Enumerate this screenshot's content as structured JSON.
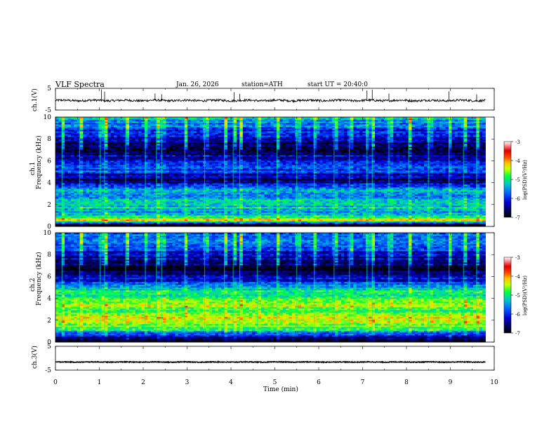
{
  "header": {
    "title": "VLF  Spectra",
    "date": "Jan. 26, 2026",
    "station": "station=ATH",
    "start": "start  UT  =   20:40:0"
  },
  "axes": {
    "x_label": "Time  (min)",
    "x_ticks": [
      "0",
      "1",
      "2",
      "3",
      "4",
      "5",
      "6",
      "7",
      "8",
      "9",
      "10"
    ],
    "ch1_label": "ch.1(V)",
    "ch3_label": "ch.3(V)",
    "ch1_spec_label": "ch.1",
    "ch2_spec_label": "ch.2",
    "freq_label": "Frequency  (kHz)",
    "wave_ticks": [
      "5",
      "-5"
    ],
    "freq_ticks": [
      "0",
      "2",
      "4",
      "6",
      "8",
      "10"
    ]
  },
  "colorbar": {
    "label": "log(PSD)(V²/Hz)",
    "ticks": [
      "-3",
      "-4",
      "-5",
      "-6",
      "-7"
    ],
    "colors": [
      "#ffffff",
      "#ff8080",
      "#e00000",
      "#ff8c00",
      "#ffff00",
      "#00ff00",
      "#00c8a0",
      "#00a0ff",
      "#0040ff",
      "#0000c0",
      "#000040",
      "#000000"
    ]
  },
  "chart_data": [
    {
      "type": "line",
      "panel": "ch.1 waveform",
      "ylabel": "ch.1(V)",
      "xlabel": "Time  (min)",
      "xlim": [
        0,
        10
      ],
      "ylim": [
        -5,
        5
      ],
      "data_xlim": [
        0,
        9.8
      ],
      "baseline": -0.6,
      "noise_amplitude": 0.5,
      "spikes": [
        {
          "x": 1.05,
          "y": 4.5
        },
        {
          "x": 1.12,
          "y": 3.5
        },
        {
          "x": 2.27,
          "y": 2.6
        },
        {
          "x": 2.42,
          "y": 2.3
        },
        {
          "x": 4.07,
          "y": 3.2
        },
        {
          "x": 4.2,
          "y": 2.4
        },
        {
          "x": 7.1,
          "y": 4.0
        },
        {
          "x": 7.22,
          "y": 4.4
        },
        {
          "x": 7.6,
          "y": 2.6
        },
        {
          "x": 8.97,
          "y": 3.6
        },
        {
          "x": 9.6,
          "y": 2.2
        }
      ]
    },
    {
      "type": "heatmap",
      "panel": "ch.1 spectrogram",
      "xlabel": "Time  (min)",
      "ylabel": "Frequency  (kHz)",
      "xlim": [
        0,
        10
      ],
      "ylim": [
        0,
        10
      ],
      "data_xlim": [
        0,
        9.8
      ],
      "zlabel": "log(PSD)(V²/Hz)",
      "zlim": [
        -7,
        -3
      ],
      "bands_khz": [
        {
          "f": 0.2,
          "logpsd": -7.0
        },
        {
          "f": 0.6,
          "logpsd": -4.3
        },
        {
          "f": 1.2,
          "logpsd": -5.4
        },
        {
          "f": 2.0,
          "logpsd": -5.2
        },
        {
          "f": 2.4,
          "logpsd": -5.5
        },
        {
          "f": 3.6,
          "logpsd": -5.6
        },
        {
          "f": 4.3,
          "logpsd": -6.8
        },
        {
          "f": 5.2,
          "logpsd": -5.8
        },
        {
          "f": 6.0,
          "logpsd": -6.0
        },
        {
          "f": 7.0,
          "logpsd": -6.9
        },
        {
          "f": 9.6,
          "logpsd": -5.4
        }
      ],
      "sferic_times_min": [
        0.15,
        0.55,
        1.02,
        1.12,
        1.6,
        2.05,
        2.3,
        2.42,
        2.95,
        3.4,
        3.85,
        4.05,
        4.2,
        4.6,
        5.05,
        5.5,
        5.9,
        6.35,
        6.7,
        7.1,
        7.22,
        7.6,
        8.05,
        8.5,
        8.97,
        9.3,
        9.6
      ]
    },
    {
      "type": "heatmap",
      "panel": "ch.2 spectrogram",
      "xlabel": "Time  (min)",
      "ylabel": "Frequency  (kHz)",
      "xlim": [
        0,
        10
      ],
      "ylim": [
        0,
        10
      ],
      "data_xlim": [
        0,
        9.8
      ],
      "zlabel": "log(PSD)(V²/Hz)",
      "zlim": [
        -7,
        -3
      ],
      "bands_khz": [
        {
          "f": 0.2,
          "logpsd": -7.0
        },
        {
          "f": 1.0,
          "logpsd": -5.2
        },
        {
          "f": 2.0,
          "logpsd": -4.3
        },
        {
          "f": 2.8,
          "logpsd": -4.8
        },
        {
          "f": 3.4,
          "logpsd": -4.5
        },
        {
          "f": 4.0,
          "logpsd": -5.0
        },
        {
          "f": 4.6,
          "logpsd": -4.8
        },
        {
          "f": 5.2,
          "logpsd": -5.6
        },
        {
          "f": 6.5,
          "logpsd": -6.9
        },
        {
          "f": 9.6,
          "logpsd": -5.6
        }
      ],
      "sferic_times_min": [
        0.15,
        0.55,
        1.02,
        1.12,
        1.6,
        2.05,
        2.3,
        2.42,
        2.95,
        3.4,
        3.85,
        4.05,
        4.2,
        4.6,
        5.05,
        5.5,
        5.9,
        6.35,
        6.7,
        7.1,
        7.22,
        7.6,
        8.05,
        8.5,
        8.97,
        9.3,
        9.6
      ]
    },
    {
      "type": "line",
      "panel": "ch.3 waveform",
      "ylabel": "ch.3(V)",
      "xlabel": "Time  (min)",
      "xlim": [
        0,
        10
      ],
      "ylim": [
        -5,
        5
      ],
      "data_xlim": [
        0,
        9.8
      ],
      "baseline": -1.6,
      "noise_amplitude": 0.15
    }
  ]
}
